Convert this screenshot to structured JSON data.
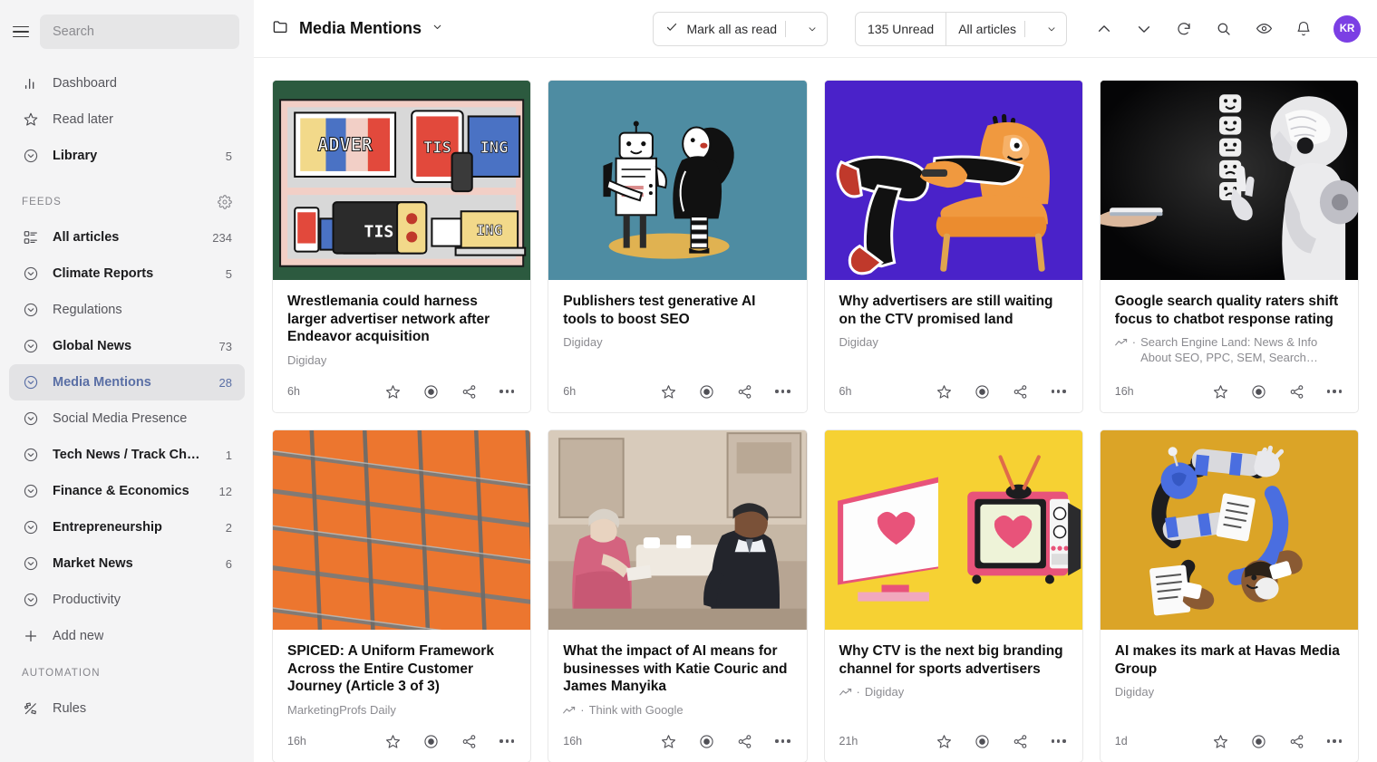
{
  "sidebar": {
    "search": {
      "placeholder": "Search",
      "value": ""
    },
    "primary": [
      {
        "label": "Dashboard",
        "count": "",
        "icon": "bar-chart-icon",
        "style": "muted"
      },
      {
        "label": "Read later",
        "count": "",
        "icon": "star-icon",
        "style": "muted"
      },
      {
        "label": "Library",
        "count": "5",
        "icon": "circle-chevron-icon",
        "style": "bold"
      }
    ],
    "feeds_header": "FEEDS",
    "feeds": [
      {
        "label": "All articles",
        "count": "234",
        "icon": "list-icon",
        "style": "bold"
      },
      {
        "label": "Climate Reports",
        "count": "5",
        "icon": "circle-chevron-icon",
        "style": "bold"
      },
      {
        "label": "Regulations",
        "count": "",
        "icon": "circle-chevron-icon",
        "style": "muted"
      },
      {
        "label": "Global News",
        "count": "73",
        "icon": "circle-chevron-icon",
        "style": "bold"
      },
      {
        "label": "Media Mentions",
        "count": "28",
        "icon": "circle-chevron-icon",
        "style": "active"
      },
      {
        "label": "Social Media Presence",
        "count": "",
        "icon": "circle-chevron-icon",
        "style": "muted"
      },
      {
        "label": "Tech News / Track Chan…",
        "count": "1",
        "icon": "circle-chevron-icon",
        "style": "bold"
      },
      {
        "label": "Finance & Economics",
        "count": "12",
        "icon": "circle-chevron-icon",
        "style": "bold"
      },
      {
        "label": "Entrepreneurship",
        "count": "2",
        "icon": "circle-chevron-icon",
        "style": "bold"
      },
      {
        "label": "Market News",
        "count": "6",
        "icon": "circle-chevron-icon",
        "style": "bold"
      },
      {
        "label": "Productivity",
        "count": "",
        "icon": "circle-chevron-icon",
        "style": "muted"
      },
      {
        "label": "Add new",
        "count": "",
        "icon": "plus-icon",
        "style": "muted"
      }
    ],
    "automation_header": "AUTOMATION",
    "automation": [
      {
        "label": "Rules",
        "count": "",
        "icon": "rules-icon",
        "style": "muted"
      }
    ]
  },
  "topbar": {
    "folder_title": "Media Mentions",
    "mark_all_read": "Mark all as read",
    "unread_count": "135 Unread",
    "filter": "All articles",
    "accent_avatar": "#7b3fe4",
    "avatar_initials": "KR"
  },
  "articles": [
    {
      "title": "Wrestlemania could harness larger advertiser network after Endeavor acquisition",
      "source": "Digiday",
      "trending": false,
      "age": "6h",
      "thumb": "th-advert",
      "thumb_alt": "advertising-screens-illustration"
    },
    {
      "title": "Publishers test generative AI tools to boost SEO",
      "source": "Digiday",
      "trending": false,
      "age": "6h",
      "thumb": "th-robot",
      "thumb_alt": "robot-and-woman-illustration"
    },
    {
      "title": "Why advertisers are still waiting on the CTV promised land",
      "source": "Digiday",
      "trending": false,
      "age": "6h",
      "thumb": "th-chair",
      "thumb_alt": "person-reclining-in-armchair-illustration"
    },
    {
      "title": "Google search quality raters shift focus to chatbot response rating",
      "source": "Search Engine Land: News & Info About SEO, PPC, SEM, Search Engines &…",
      "trending": true,
      "age": "16h",
      "thumb": "th-ai",
      "thumb_alt": "robot-rating-emoji-faces-photo"
    },
    {
      "title": "SPICED: A Uniform Framework Across the Entire Customer Journey (Article 3 of 3)",
      "source": "MarketingProfs Daily",
      "trending": false,
      "age": "16h",
      "thumb": "th-grid",
      "thumb_alt": "metal-grid-on-orange-photo"
    },
    {
      "title": "What the impact of AI means for businesses with Katie Couric and James Manyika",
      "source": "Think with Google",
      "trending": true,
      "age": "16h",
      "thumb": "th-interview",
      "thumb_alt": "interview-two-people-seated-photo"
    },
    {
      "title": "Why CTV is the next big branding channel for sports advertisers",
      "source": "Digiday",
      "trending": true,
      "age": "21h",
      "thumb": "th-ctv",
      "thumb_alt": "tv-screens-with-hearts-illustration"
    },
    {
      "title": "AI makes its mark at Havas Media Group",
      "source": "Digiday",
      "trending": false,
      "age": "1d",
      "thumb": "th-havas",
      "thumb_alt": "robot-and-human-arms-illustration"
    }
  ]
}
